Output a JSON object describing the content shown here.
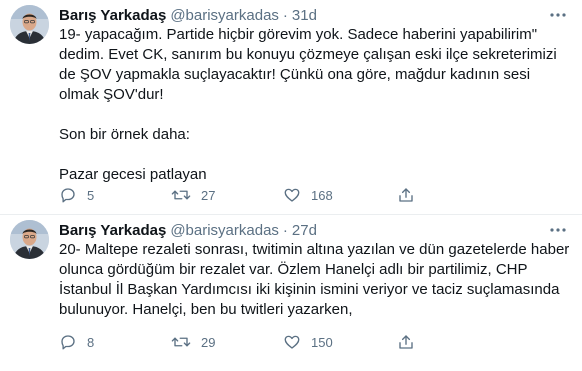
{
  "tweets": [
    {
      "display_name": "Barış Yarkadaş",
      "handle": "@barisyarkadas",
      "separator": "·",
      "time": "31d",
      "paragraphs": [
        "19- yapacağım. Partide hiçbir görevim yok. Sadece haberini yapabilirim\" dedim. Evet CK, sanırım bu konuyu çözmeye çalışan eski ilçe sekreterimizi de ŞOV yapmakla suçlayacaktır! Çünkü ona göre, mağdur kadının sesi olmak ŞOV'dur!",
        "Son bir örnek daha:",
        "Pazar gecesi patlayan"
      ],
      "replies": "5",
      "retweets": "27",
      "likes": "168"
    },
    {
      "display_name": "Barış Yarkadaş",
      "handle": "@barisyarkadas",
      "separator": "·",
      "time": "27d",
      "paragraphs": [
        "20- Maltepe rezaleti sonrası, twitimin altına yazılan ve dün gazetelerde haber olunca gördüğüm bir rezalet var. Özlem Hanelçi adlı bir partilimiz, CHP İstanbul İl Başkan Yardımcısı iki kişinin ismini veriyor ve taciz suçlamasında bulunuyor. Hanelçi, ben bu twitleri yazarken,"
      ],
      "replies": "8",
      "retweets": "29",
      "likes": "150"
    }
  ],
  "icons": {
    "avatar": "avatar",
    "more": "more-icon",
    "reply": "reply-icon",
    "retweet": "retweet-icon",
    "like": "like-icon",
    "share": "share-icon"
  },
  "colors": {
    "text": "#0f1419",
    "secondary": "#5b7083",
    "divider": "#ebeef0"
  }
}
